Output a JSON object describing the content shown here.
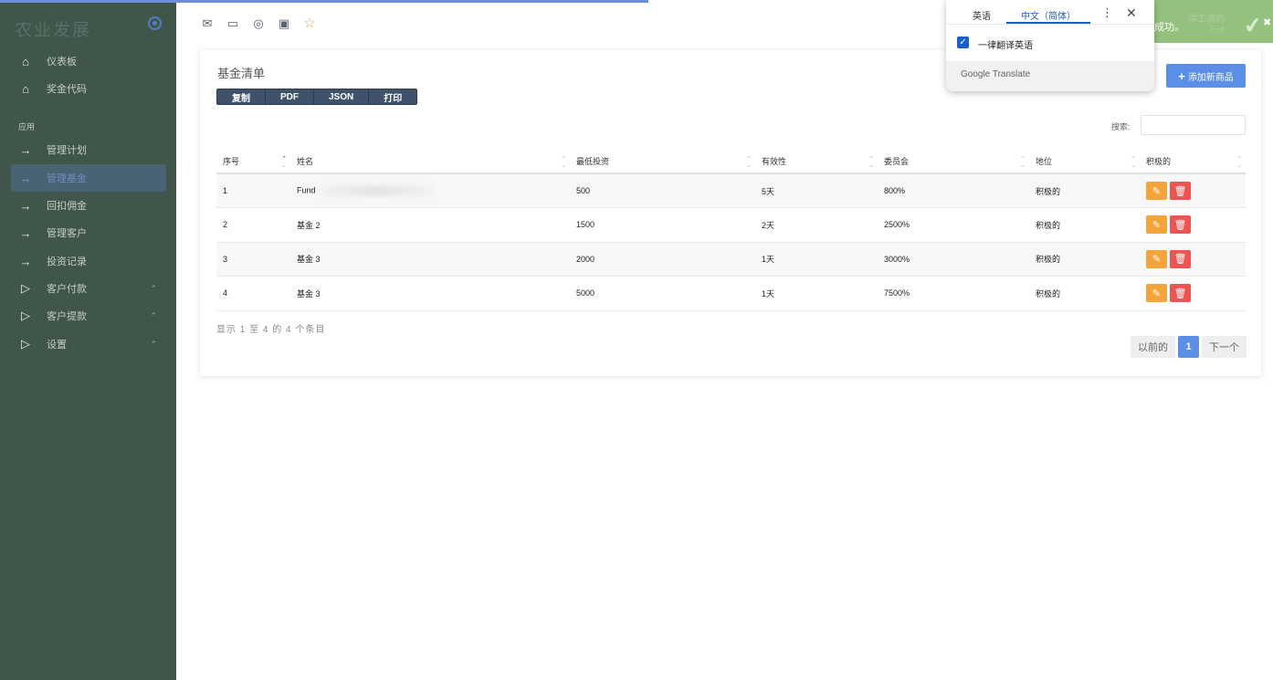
{
  "app": {
    "title": "农业发展"
  },
  "sidebar": {
    "items": [
      {
        "label": "仪表板",
        "icon": "home-icon"
      },
      {
        "label": "奖金代码",
        "icon": "home-icon"
      }
    ],
    "section_label": "应用",
    "app_items": [
      {
        "label": "管理计划",
        "icon": "arrow-right-icon"
      },
      {
        "label": "管理基金",
        "icon": "arrow-right-icon",
        "active": true
      },
      {
        "label": "回扣佣金",
        "icon": "arrow-right-icon"
      },
      {
        "label": "管理客户",
        "icon": "arrow-right-icon"
      },
      {
        "label": "投资记录",
        "icon": "arrow-right-icon"
      },
      {
        "label": "客户付款",
        "icon": "play-icon",
        "expandable": true
      },
      {
        "label": "客户提款",
        "icon": "play-icon",
        "expandable": true
      },
      {
        "label": "设置",
        "icon": "play-icon",
        "expandable": true
      }
    ]
  },
  "toolbar": {
    "icons": [
      "mail-icon",
      "chat-icon",
      "check-circle-icon",
      "calendar-icon",
      "star-icon"
    ]
  },
  "card": {
    "title": "基金清单",
    "export_buttons": [
      "复制",
      "PDF",
      "JSON",
      "打印"
    ],
    "add_button": "添加新商品",
    "search_label": "搜索:",
    "search_value": ""
  },
  "table": {
    "headers": [
      "序号",
      "姓名",
      "最低投资",
      "有效性",
      "委员会",
      "地位",
      "积极的"
    ],
    "rows": [
      {
        "no": "1",
        "name": "Fund",
        "min": "500",
        "validity": "5天",
        "commission": "800%",
        "status": "积极的"
      },
      {
        "no": "2",
        "name": "基金 2",
        "min": "1500",
        "validity": "2天",
        "commission": "2500%",
        "status": "积极的"
      },
      {
        "no": "3",
        "name": "基金 3",
        "min": "2000",
        "validity": "1天",
        "commission": "3000%",
        "status": "积极的"
      },
      {
        "no": "4",
        "name": "基金 3",
        "min": "5000",
        "validity": "1天",
        "commission": "7500%",
        "status": "积极的"
      }
    ],
    "info": "显示 1 至 4 的 4 个条目"
  },
  "pagination": {
    "prev": "以前的",
    "current": "1",
    "next": "下一个"
  },
  "translate_popup": {
    "tab_source": "英语",
    "tab_target": "中文（简体）",
    "always_translate": "一律翻译英语",
    "brand": "Google Translate"
  },
  "toast": {
    "text": "成功。",
    "faint_text": "得工资的",
    "faint_text2": "行动"
  },
  "colors": {
    "sidebar": "#41564a",
    "primary": "#5b8ee6",
    "edit": "#f3a53b",
    "delete": "#ee5453"
  }
}
